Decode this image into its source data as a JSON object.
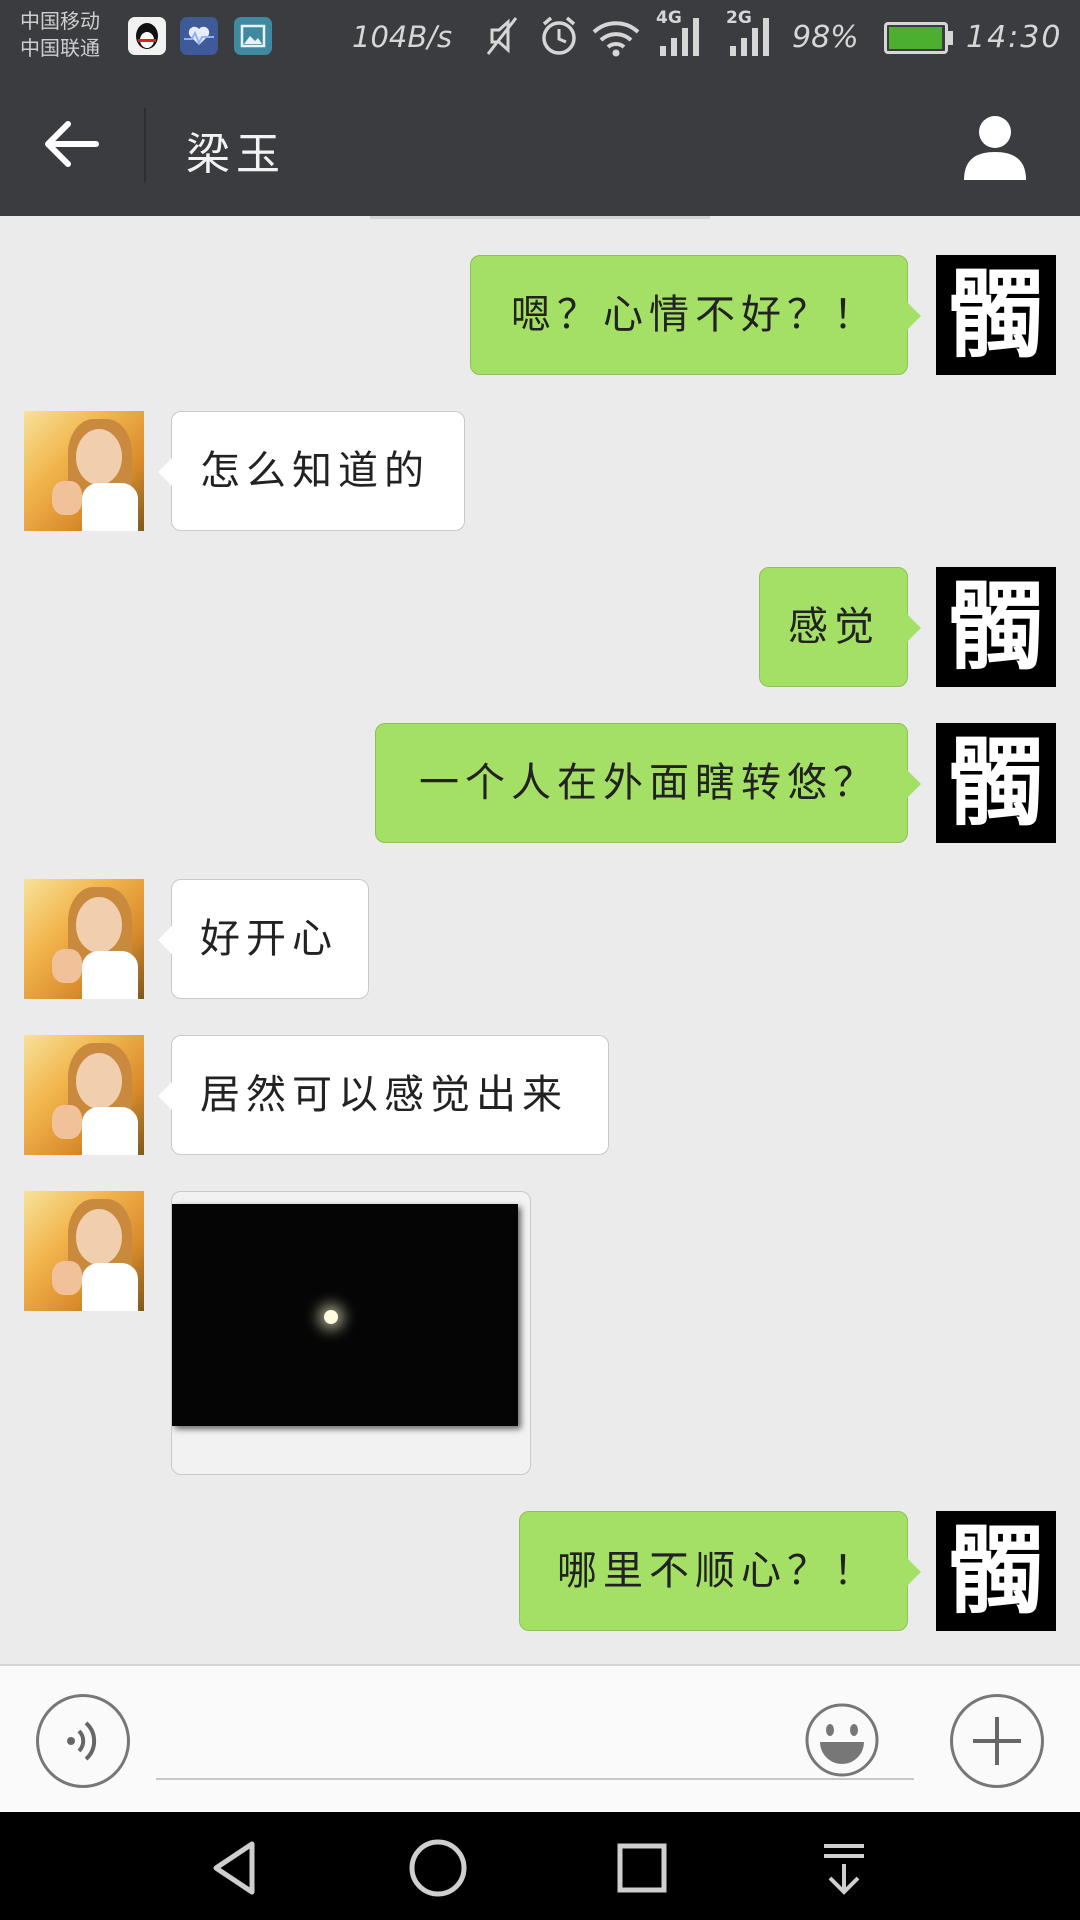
{
  "status_bar": {
    "carrier_1": "中国移动",
    "carrier_2": "中国联通",
    "net_speed": "104B/s",
    "network_1": "4G",
    "network_2": "2G",
    "battery": "98%",
    "battery_level": 0.98,
    "time": "14:30",
    "icons": [
      "qq-icon",
      "health-icon",
      "gallery-icon",
      "mute-icon",
      "alarm-icon",
      "wifi-icon",
      "signal-icon",
      "signal-icon",
      "battery-icon"
    ]
  },
  "header": {
    "title": "梁玉",
    "back_icon": "arrow-left-icon",
    "profile_icon": "person-icon"
  },
  "me_avatar_char": "髑",
  "messages": [
    {
      "side": "out",
      "text": "嗯？心情不好？！"
    },
    {
      "side": "in",
      "text": "怎么知道的"
    },
    {
      "side": "out",
      "text": "感觉"
    },
    {
      "side": "out",
      "text": "一个人在外面瞎转悠？"
    },
    {
      "side": "in",
      "text": "好开心"
    },
    {
      "side": "in",
      "text": "居然可以感觉出来"
    },
    {
      "side": "in",
      "type": "image",
      "text": ""
    },
    {
      "side": "out",
      "text": "哪里不顺心？！"
    }
  ],
  "colors": {
    "bar_bg": "#3b3c40",
    "chat_bg": "#ebebeb",
    "outgoing_bubble": "#a5e066",
    "incoming_bubble": "#ffffff"
  },
  "input": {
    "placeholder": "",
    "value": "",
    "voice_icon": "voice-icon",
    "emoji_icon": "emoji-icon",
    "plus_icon": "plus-icon"
  },
  "nav": [
    "back-triangle-icon",
    "home-circle-icon",
    "recents-square-icon",
    "notification-pulldown-icon"
  ]
}
